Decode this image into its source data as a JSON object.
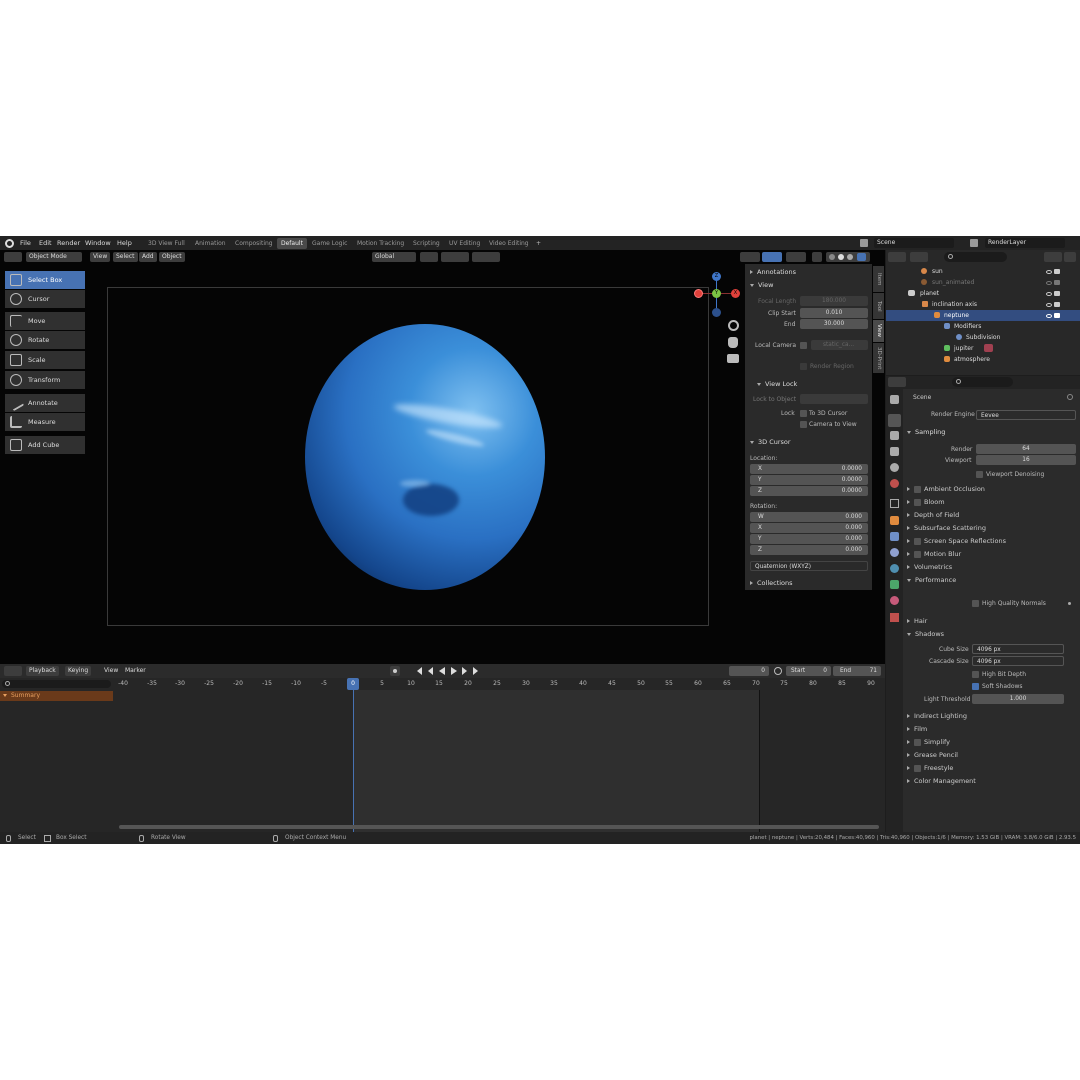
{
  "topbar": {
    "menus": [
      "File",
      "Edit",
      "Render",
      "Window",
      "Help"
    ],
    "workspaces": [
      "3D View Full",
      "Animation",
      "Compositing",
      "Default",
      "Game Logic",
      "Motion Tracking",
      "Scripting",
      "UV Editing",
      "Video Editing"
    ],
    "active_workspace": "Default",
    "add_tab": "+",
    "scene": "Scene",
    "render_layer": "RenderLayer"
  },
  "viewport_header": {
    "mode": "Object Mode",
    "menus": [
      "View",
      "Select",
      "Add",
      "Object"
    ],
    "orientation": "Global"
  },
  "toolbar": {
    "tools": [
      "Select Box",
      "Cursor",
      "Move",
      "Rotate",
      "Scale",
      "Transform",
      "Annotate",
      "Measure",
      "Add Cube"
    ],
    "active": "Select Box"
  },
  "gizmo": {
    "z": "Z",
    "x": "X",
    "y": "Y"
  },
  "npanel": {
    "tabs": [
      "Item",
      "Tool",
      "View",
      "3D-Print"
    ],
    "annotations": "Annotations",
    "view": "View",
    "focal_length_label": "Focal Length",
    "focal_length": "180.000",
    "clip_start_label": "Clip Start",
    "clip_start": "0.010",
    "end_label": "End",
    "end": "30.000",
    "local_camera_label": "Local Camera",
    "local_camera_value": "static_ca...",
    "render_region": "Render Region",
    "view_lock": "View Lock",
    "lock_to_object": "Lock to Object",
    "lock_label": "Lock",
    "to_3d_cursor": "To 3D Cursor",
    "camera_to_view": "Camera to View",
    "cursor_3d": "3D Cursor",
    "location_label": "Location:",
    "location": [
      {
        "axis": "X",
        "value": "0.0000"
      },
      {
        "axis": "Y",
        "value": "0.0000"
      },
      {
        "axis": "Z",
        "value": "0.0000"
      }
    ],
    "rotation_label": "Rotation:",
    "rotation": [
      {
        "axis": "W",
        "value": "0.000"
      },
      {
        "axis": "X",
        "value": "0.000"
      },
      {
        "axis": "Y",
        "value": "0.000"
      },
      {
        "axis": "Z",
        "value": "0.000"
      }
    ],
    "rotation_mode": "Quaternion (WXYZ)",
    "collections": "Collections"
  },
  "outliner": {
    "rows": [
      {
        "label": "sun"
      },
      {
        "label": "sun_animated"
      },
      {
        "label": "planet"
      },
      {
        "label": "inclination axis"
      },
      {
        "label": "neptune"
      },
      {
        "label": "Modifiers"
      },
      {
        "label": "Subdivision"
      },
      {
        "label": "jupiter"
      },
      {
        "label": "atmosphere"
      }
    ]
  },
  "properties": {
    "breadcrumb": "Scene",
    "render_engine_label": "Render Engine",
    "render_engine": "Eevee",
    "sampling": "Sampling",
    "render_label": "Render",
    "render_samples": "64",
    "viewport_label": "Viewport",
    "viewport_samples": "16",
    "viewport_denoising": "Viewport Denoising",
    "panels_a": [
      "Ambient Occlusion",
      "Bloom",
      "Depth of Field",
      "Subsurface Scattering",
      "Screen Space Reflections",
      "Motion Blur",
      "Volumetrics",
      "Performance"
    ],
    "high_quality_normals": "High Quality Normals",
    "hair": "Hair",
    "shadows": "Shadows",
    "cube_size_label": "Cube Size",
    "cube_size": "4096 px",
    "cascade_size_label": "Cascade Size",
    "cascade_size": "4096 px",
    "high_bit_depth": "High Bit Depth",
    "soft_shadows": "Soft Shadows",
    "light_threshold_label": "Light Threshold",
    "light_threshold": "1.000",
    "panels_b": [
      "Indirect Lighting",
      "Film",
      "Simplify",
      "Grease Pencil",
      "Freestyle",
      "Color Management"
    ]
  },
  "timeline": {
    "menus": [
      "Playback",
      "Keying",
      "View",
      "Marker"
    ],
    "current_frame": "0",
    "start_label": "Start",
    "start": "0",
    "end_label": "End",
    "end": "71",
    "summary": "Summary",
    "ticks": [
      "-40",
      "-35",
      "-30",
      "-25",
      "-20",
      "-15",
      "-10",
      "-5",
      "0",
      "5",
      "10",
      "15",
      "20",
      "25",
      "30",
      "35",
      "40",
      "45",
      "50",
      "55",
      "60",
      "65",
      "70",
      "75",
      "80",
      "85",
      "90"
    ],
    "playhead": "0"
  },
  "statusbar": {
    "select": "Select",
    "box_select": "Box Select",
    "rotate_view": "Rotate View",
    "context_menu": "Object Context Menu",
    "stats": "planet | neptune | Verts:20,484 | Faces:40,960 | Tris:40,960 | Objects:1/6 | Memory: 1.53 GiB | VRAM: 3.8/6.0 GiB | 2.93.5"
  },
  "colors": {
    "accent": "#4772b3",
    "planet": "#2f7fce",
    "x_axis": "#e0413b",
    "y_axis": "#7bc444",
    "z_axis": "#3f76c9"
  }
}
